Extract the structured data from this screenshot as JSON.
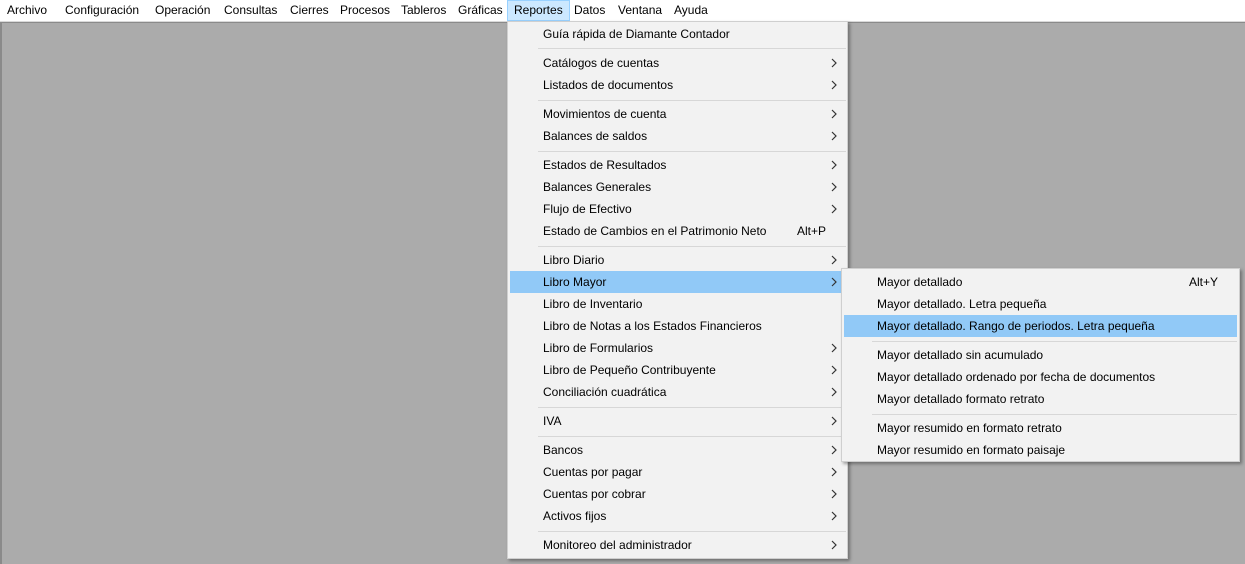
{
  "menubar": {
    "items": [
      {
        "label": "Archivo"
      },
      {
        "label": "Configuración"
      },
      {
        "label": "Operación"
      },
      {
        "label": "Consultas"
      },
      {
        "label": "Cierres"
      },
      {
        "label": "Procesos"
      },
      {
        "label": "Tableros"
      },
      {
        "label": "Gráficas"
      },
      {
        "label": "Reportes"
      },
      {
        "label": "Datos"
      },
      {
        "label": "Ventana"
      },
      {
        "label": "Ayuda"
      }
    ]
  },
  "reportes_menu": {
    "items": [
      {
        "label": "Guía rápida de Diamante Contador"
      },
      {
        "label": "Catálogos de cuentas"
      },
      {
        "label": "Listados de documentos"
      },
      {
        "label": "Movimientos de cuenta"
      },
      {
        "label": "Balances de saldos"
      },
      {
        "label": "Estados de Resultados"
      },
      {
        "label": "Balances Generales"
      },
      {
        "label": "Flujo de Efectivo"
      },
      {
        "label": "Estado de Cambios en el Patrimonio Neto",
        "shortcut": "Alt+P"
      },
      {
        "label": "Libro Diario"
      },
      {
        "label": "Libro Mayor"
      },
      {
        "label": "Libro de Inventario"
      },
      {
        "label": "Libro de Notas a los Estados Financieros"
      },
      {
        "label": "Libro de Formularios"
      },
      {
        "label": "Libro de Pequeño Contribuyente"
      },
      {
        "label": "Conciliación cuadrática"
      },
      {
        "label": "IVA"
      },
      {
        "label": "Bancos"
      },
      {
        "label": "Cuentas por pagar"
      },
      {
        "label": "Cuentas por cobrar"
      },
      {
        "label": "Activos fijos"
      },
      {
        "label": "Monitoreo del administrador"
      }
    ]
  },
  "libro_mayor_submenu": {
    "items": [
      {
        "label": "Mayor detallado",
        "shortcut": "Alt+Y"
      },
      {
        "label": "Mayor detallado. Letra pequeña"
      },
      {
        "label": "Mayor detallado. Rango de periodos. Letra pequeña"
      },
      {
        "label": "Mayor detallado sin acumulado"
      },
      {
        "label": "Mayor detallado ordenado por fecha de documentos"
      },
      {
        "label": "Mayor detallado formato retrato"
      },
      {
        "label": "Mayor resumido en formato retrato"
      },
      {
        "label": "Mayor resumido en formato paisaje"
      }
    ]
  },
  "colors": {
    "workspace": "#ababab",
    "menu_background": "#f2f2f2",
    "highlight": "#91c9f7",
    "menubar_active": "#cce8ff"
  },
  "icons": {
    "submenu_arrow": "chevron-right-icon"
  }
}
